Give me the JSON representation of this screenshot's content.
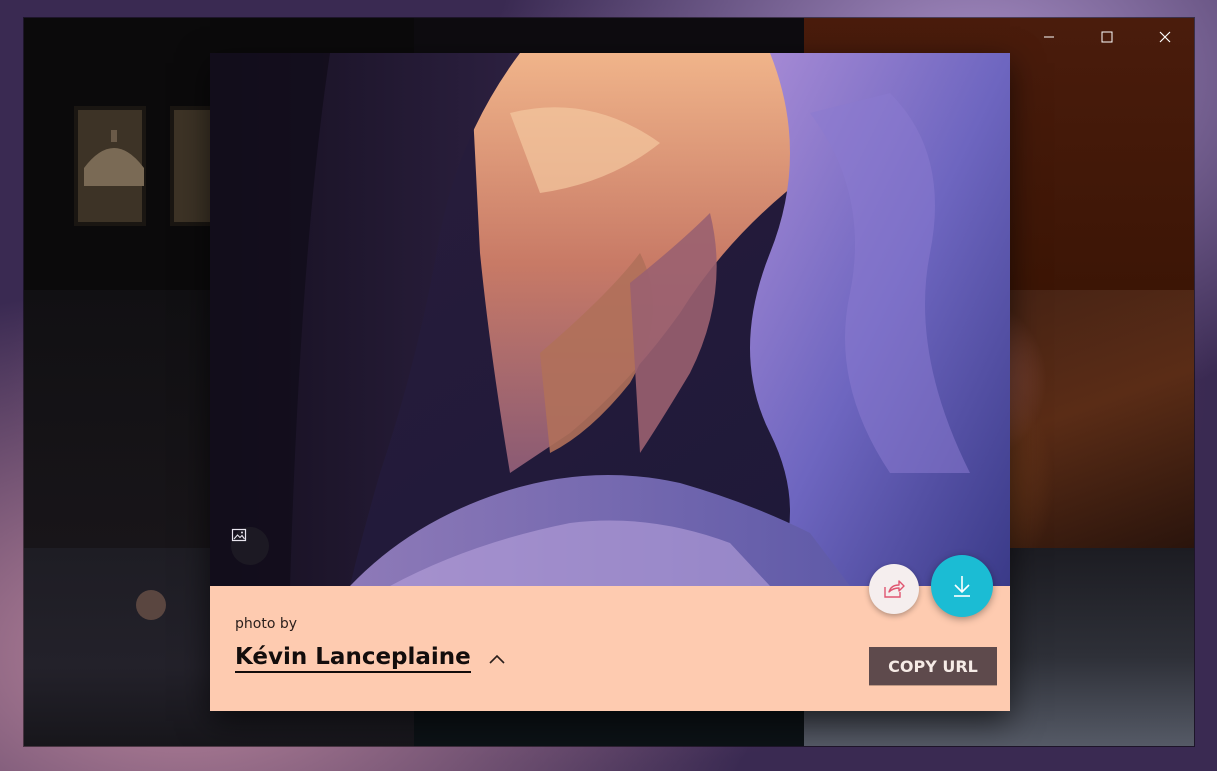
{
  "window": {
    "controls": {
      "minimize_icon": "minimize-icon",
      "maximize_icon": "maximize-icon",
      "close_icon": "close-icon"
    }
  },
  "photo": {
    "credit_prefix": "photo by",
    "author_name": "Kévin Lanceplaine",
    "copy_url_label": "COPY URL",
    "icons": {
      "image_icon": "image-icon",
      "share_icon": "share-icon",
      "download_icon": "download-icon",
      "expand_icon": "chevron-up-icon"
    }
  },
  "colors": {
    "info_panel_bg": "#fecbb0",
    "download_accent": "#1bbcd4",
    "copy_url_bg": "#5e4a4c",
    "share_icon_color": "#e05570"
  }
}
